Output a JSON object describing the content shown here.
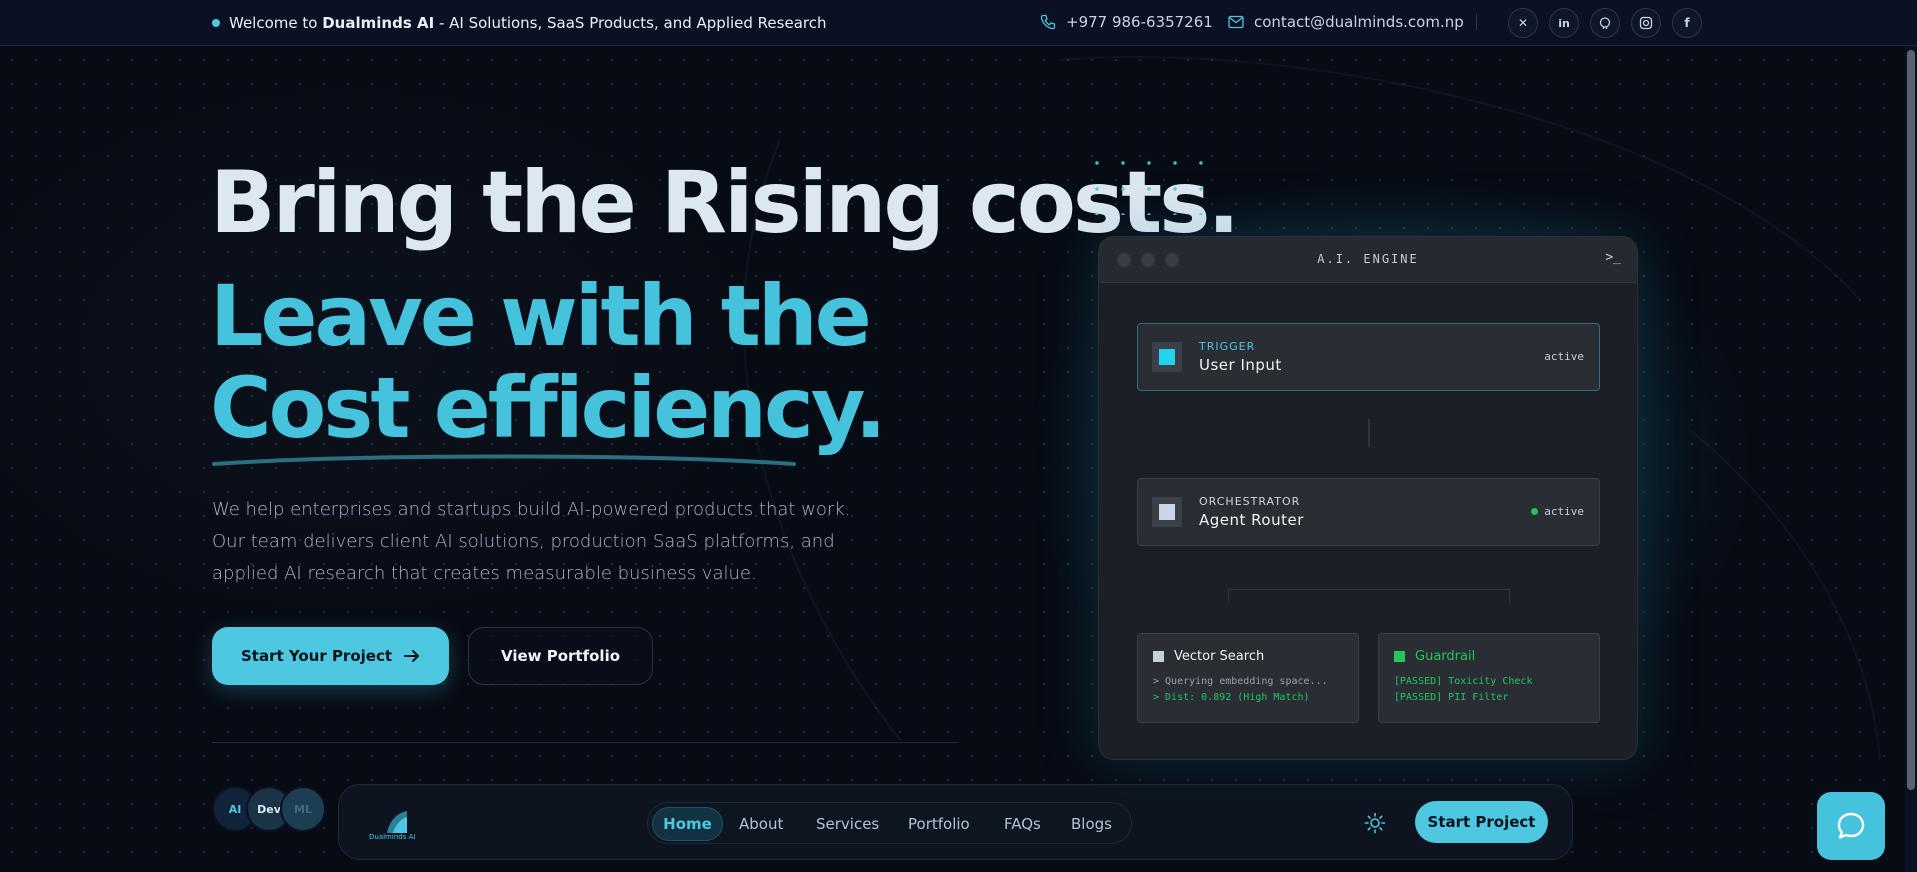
{
  "topbar": {
    "welcome_prefix": "Welcome to",
    "brand": "Dualminds AI",
    "welcome_suffix": "- AI Solutions, SaaS Products, and Applied Research",
    "phone": "+977 986-6357261",
    "email": "contact@dualminds.com.np",
    "socials": [
      "x-icon",
      "linkedin-icon",
      "github-icon",
      "instagram-icon",
      "facebook-icon"
    ]
  },
  "hero": {
    "line1": "Bring the Rising costs.",
    "line2": "Leave with the",
    "line3": "Cost efficiency.",
    "description": "We help enterprises and startups build AI-powered products that work. Our team delivers client AI solutions, production SaaS platforms, and applied AI research that creates measurable business value.",
    "primary_button": "Start Your Project",
    "secondary_button": "View Portfolio"
  },
  "engine": {
    "title": "A.I. ENGINE",
    "prompt": ">_",
    "trigger": {
      "kind": "TRIGGER",
      "name": "User Input",
      "status": "active"
    },
    "orchestrator": {
      "kind": "ORCHESTRATOR",
      "name": "Agent Router",
      "status": "active"
    },
    "vector_search": {
      "title": "Vector Search",
      "line1": "> Querying embedding space...",
      "line2": "> Dist: 0.892 (High Match)"
    },
    "guardrail": {
      "title": "Guardrail",
      "line1": "[PASSED] Toxicity Check",
      "line2": "[PASSED] PII Filter"
    }
  },
  "avatars": [
    "AI",
    "Dev",
    "ML"
  ],
  "nav": {
    "logo_text": "Dualminds AI",
    "items": [
      "Home",
      "About",
      "Services",
      "Portfolio",
      "FAQs",
      "Blogs"
    ],
    "active": "Home",
    "start_button": "Start Project"
  },
  "colors": {
    "accent": "#4ec7e0",
    "background": "#070b14",
    "success": "#22c55e"
  }
}
